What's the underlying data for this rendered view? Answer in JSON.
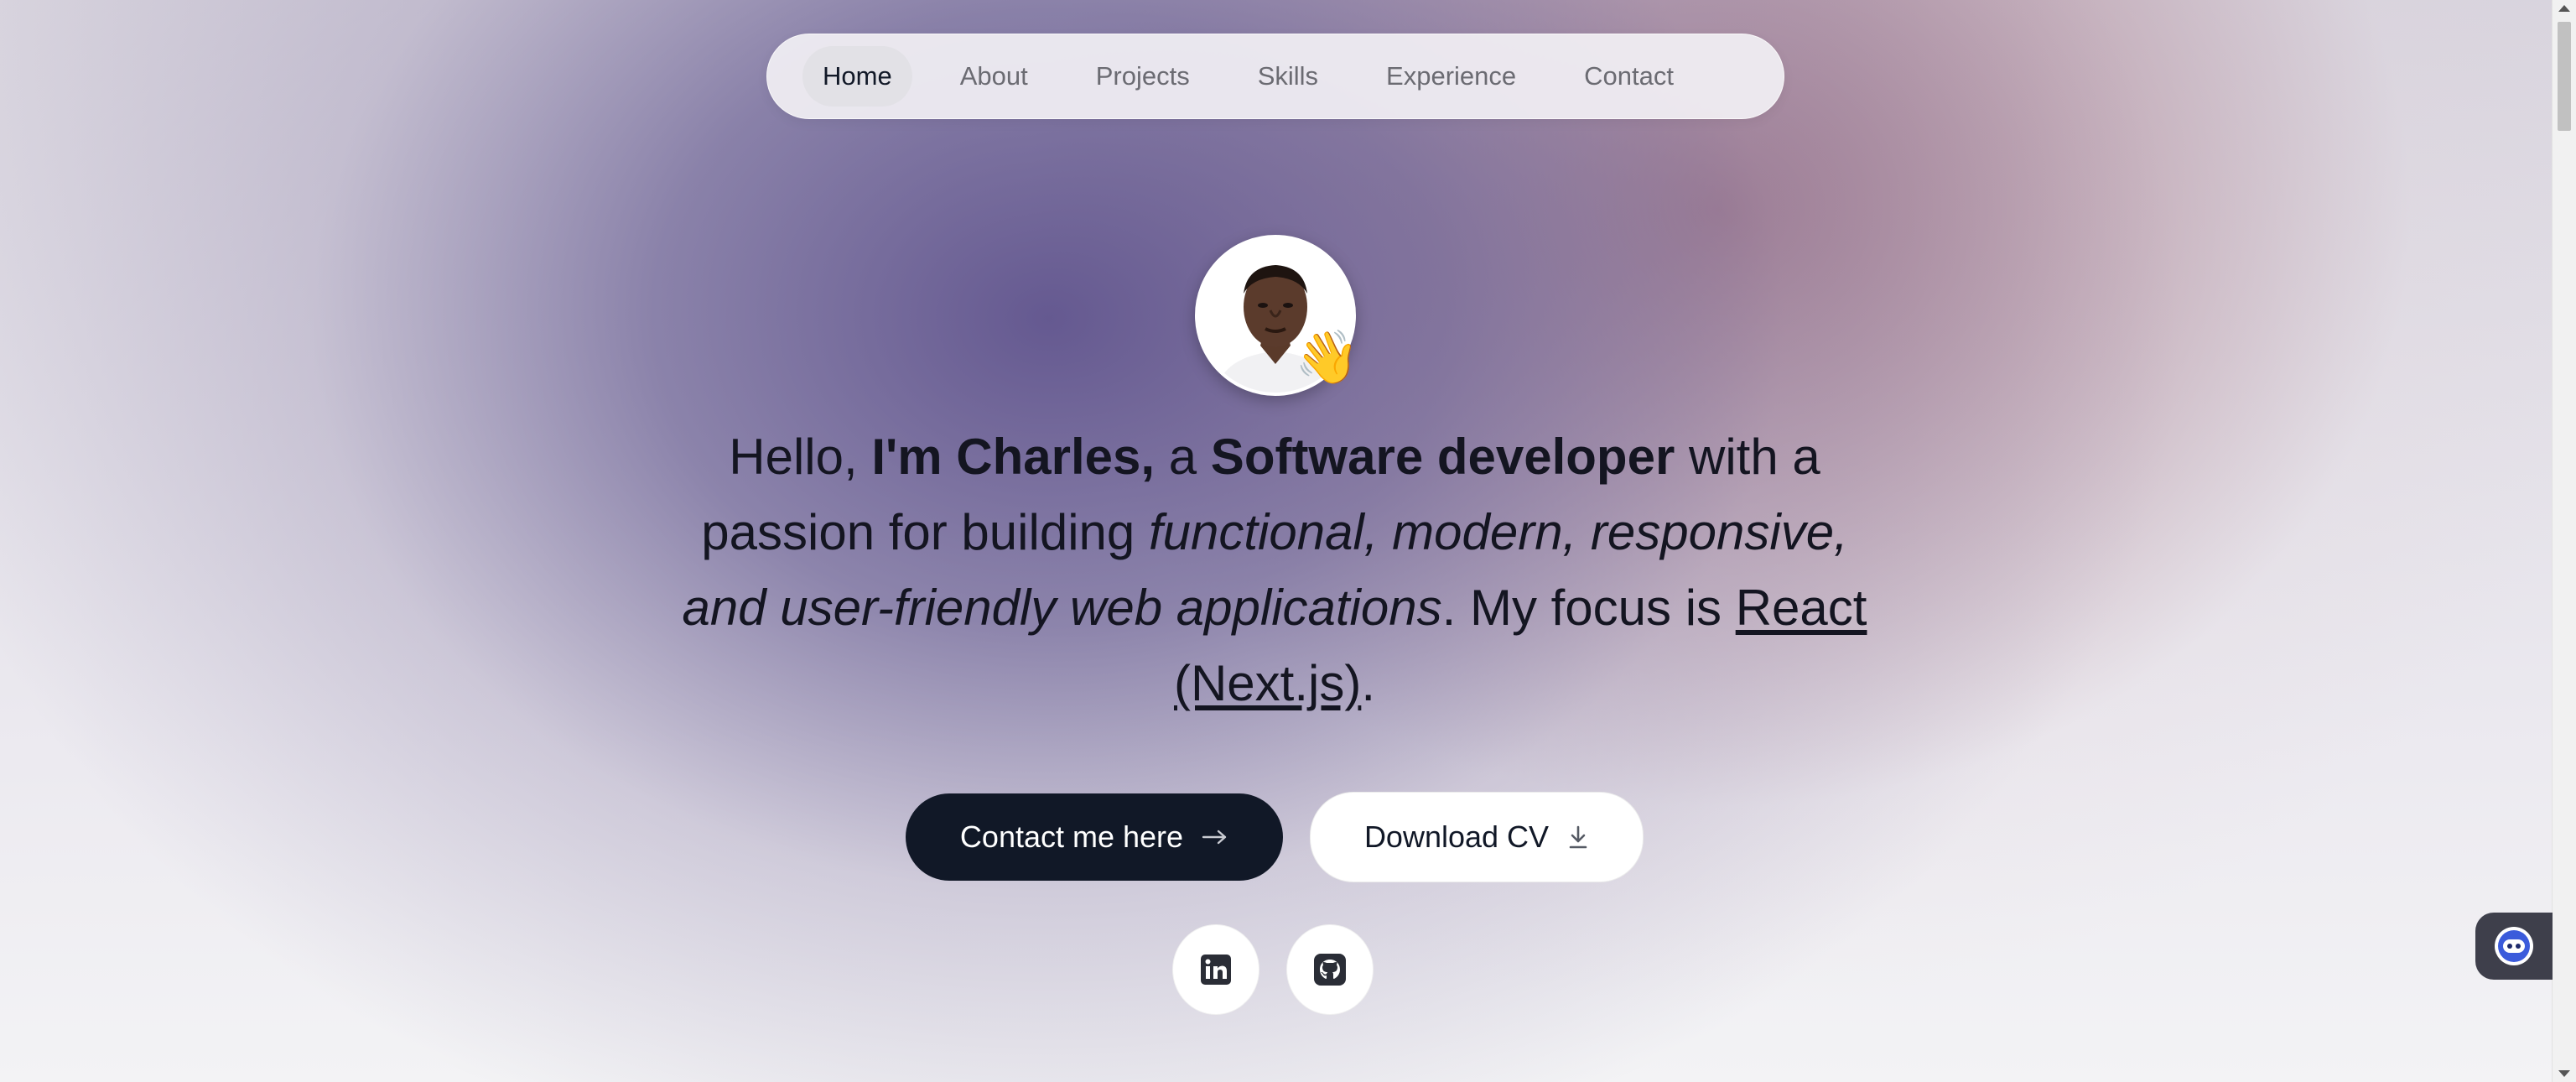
{
  "nav": {
    "items": [
      {
        "label": "Home",
        "active": true
      },
      {
        "label": "About",
        "active": false
      },
      {
        "label": "Projects",
        "active": false
      },
      {
        "label": "Skills",
        "active": false
      },
      {
        "label": "Experience",
        "active": false
      },
      {
        "label": "Contact",
        "active": false
      }
    ]
  },
  "hero": {
    "avatar_emoji": "👋",
    "intro": {
      "p1": "Hello, ",
      "name": "I'm Charles,",
      "p2": " a ",
      "role": "Software developer",
      "p3": " with a passion for building ",
      "italic": "functional, modern, responsive, and user-friendly web applications",
      "p4": ". My focus is ",
      "focus": "React (Next.js)",
      "p5": "."
    }
  },
  "buttons": {
    "contact_label": "Contact me here",
    "cv_label": "Download CV"
  },
  "social": {
    "linkedin_icon": "linkedin-icon",
    "github_icon": "github-icon"
  },
  "colors": {
    "primary_button": "#111827",
    "text": "#141521"
  }
}
